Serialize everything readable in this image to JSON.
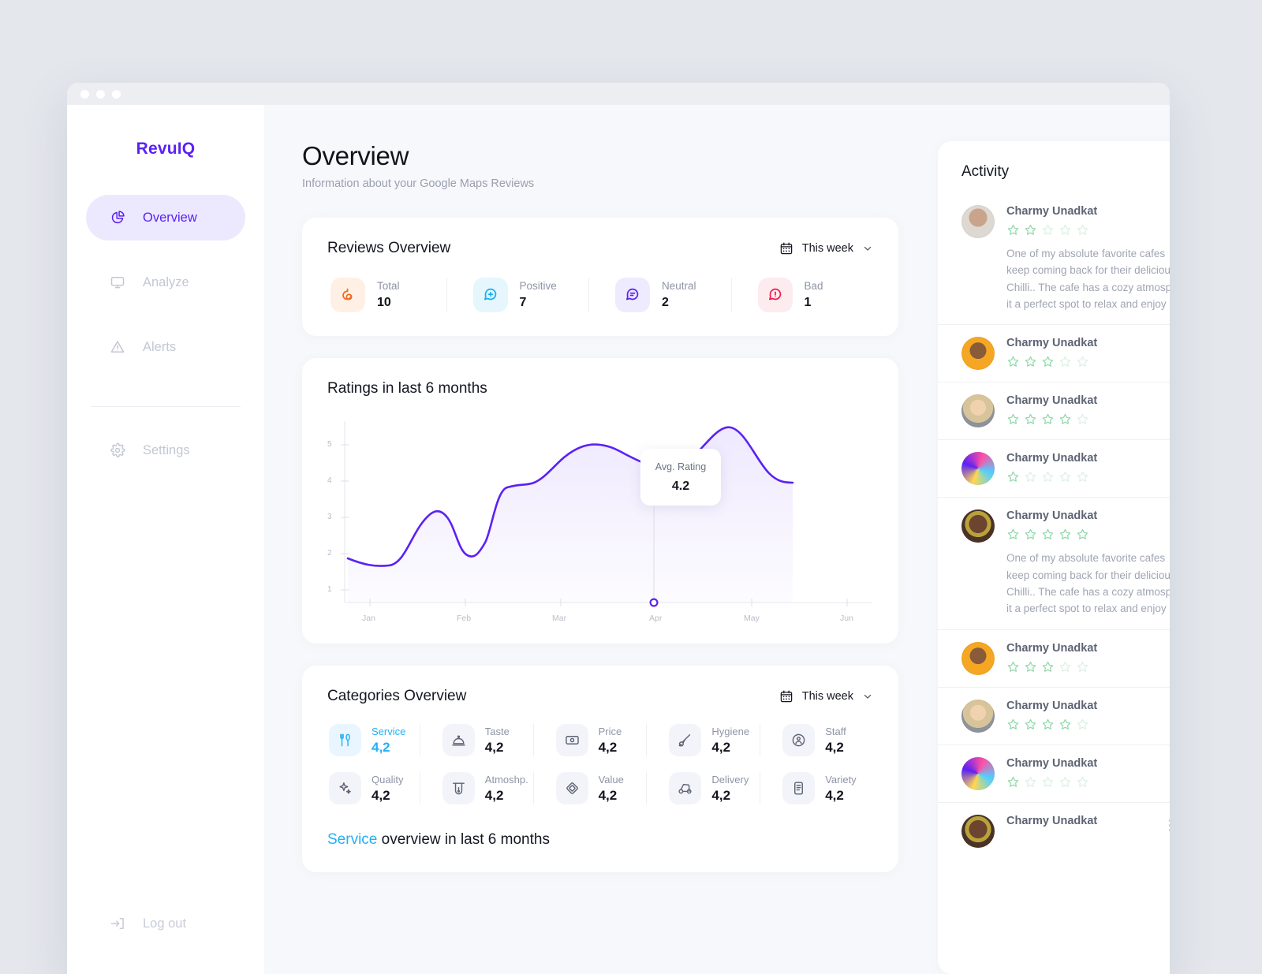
{
  "sidebar": {
    "logo": "RevuIQ",
    "items": [
      {
        "label": "Overview",
        "icon": "pie-chart-icon",
        "active": true
      },
      {
        "label": "Analyze",
        "icon": "monitor-icon",
        "active": false
      },
      {
        "label": "Alerts",
        "icon": "alert-triangle-icon",
        "active": false
      },
      {
        "label": "Settings",
        "icon": "gear-icon",
        "active": false
      }
    ],
    "logout": {
      "label": "Log out",
      "icon": "logout-icon"
    }
  },
  "header": {
    "title": "Overview",
    "subtitle": "Information about your Google Maps Reviews"
  },
  "reviews_overview": {
    "title": "Reviews Overview",
    "period": "This week",
    "stats": [
      {
        "label": "Total",
        "value": "10",
        "icon": "message-total-icon",
        "color": "#f26b1d",
        "bg": "#fff0e6"
      },
      {
        "label": "Positive",
        "value": "7",
        "icon": "message-plus-icon",
        "color": "#17b0f0",
        "bg": "#e6f6fd"
      },
      {
        "label": "Neutral",
        "value": "2",
        "icon": "message-neutral-icon",
        "color": "#5b21f5",
        "bg": "#eeebfe"
      },
      {
        "label": "Bad",
        "value": "1",
        "icon": "message-alert-icon",
        "color": "#f5194b",
        "bg": "#fdecef"
      }
    ]
  },
  "ratings_chart": {
    "title": "Ratings in last 6 months",
    "tooltip": {
      "label": "Avg. Rating",
      "value": "4.2"
    }
  },
  "chart_data": {
    "type": "line",
    "title": "Ratings in last 6 months",
    "xlabel": "",
    "ylabel": "",
    "categories": [
      "Jan",
      "Feb",
      "Mar",
      "Apr",
      "May",
      "Jun"
    ],
    "ylim": [
      0.5,
      5.7
    ],
    "yticks": [
      1,
      2,
      3,
      4,
      5
    ],
    "grid": false,
    "legend": false,
    "area_fill": true,
    "line_color": "#5b21f5",
    "annotation": {
      "label": "Avg. Rating",
      "value": 4.2,
      "x": "mid-Apr"
    },
    "series": [
      {
        "name": "Avg. Rating",
        "x": [
          "Jan",
          "Jan+",
          "Feb-",
          "Feb",
          "Feb+",
          "Mar-",
          "Mar",
          "Mar+",
          "Apr",
          "Apr+",
          "May-",
          "May",
          "May+",
          "Jun"
        ],
        "values": [
          1.95,
          1.72,
          3.3,
          2.9,
          2.15,
          3.8,
          3.85,
          4.4,
          5.25,
          4.92,
          4.88,
          5.15,
          5.55,
          4.6
        ]
      }
    ]
  },
  "categories_overview": {
    "title": "Categories Overview",
    "period": "This week",
    "rows": [
      [
        {
          "label": "Service",
          "value": "4,2",
          "icon": "cutlery-icon",
          "highlight": true
        },
        {
          "label": "Taste",
          "value": "4,2",
          "icon": "food-dome-icon",
          "highlight": false
        },
        {
          "label": "Price",
          "value": "4,2",
          "icon": "banknote-icon",
          "highlight": false
        },
        {
          "label": "Hygiene",
          "value": "4,2",
          "icon": "brush-icon",
          "highlight": false
        },
        {
          "label": "Staff",
          "value": "4,2",
          "icon": "user-badge-icon",
          "highlight": false
        }
      ],
      [
        {
          "label": "Quality",
          "value": "4,2",
          "icon": "sparkles-icon",
          "highlight": false
        },
        {
          "label": "Atmoshp.",
          "value": "4,2",
          "icon": "lamp-icon",
          "highlight": false
        },
        {
          "label": "Value",
          "value": "4,2",
          "icon": "diamond-icon",
          "highlight": false
        },
        {
          "label": "Delivery",
          "value": "4,2",
          "icon": "scooter-icon",
          "highlight": false
        },
        {
          "label": "Variety",
          "value": "4,2",
          "icon": "list-card-icon",
          "highlight": false
        }
      ]
    ],
    "footer_accent": "Service",
    "footer_rest": " overview in last 6 months"
  },
  "activity": {
    "title": "Activity",
    "review_text": "One of my absolute favorite cafes ... keep coming back for their delicious ... Chilli.. The cafe has a cozy atmosph... it a perfect spot to relax and enjoy ...",
    "review_lines": [
      "One of my absolute favorite cafes",
      "keep coming back for their deliciou",
      "Chilli.. The cafe has a cozy atmosp",
      "it a perfect spot to relax and enjoy"
    ],
    "items": [
      {
        "name": "Charmy Unadkat",
        "rating": 2,
        "avatar": "avatar-1",
        "has_text": true,
        "kebab": false
      },
      {
        "name": "Charmy Unadkat",
        "rating": 3,
        "avatar": "avatar-2",
        "has_text": false,
        "kebab": false
      },
      {
        "name": "Charmy Unadkat",
        "rating": 4,
        "avatar": "avatar-3",
        "has_text": false,
        "kebab": false
      },
      {
        "name": "Charmy Unadkat",
        "rating": 1,
        "avatar": "avatar-4",
        "has_text": false,
        "kebab": false
      },
      {
        "name": "Charmy Unadkat",
        "rating": 5,
        "avatar": "avatar-5",
        "has_text": true,
        "kebab": false
      },
      {
        "name": "Charmy Unadkat",
        "rating": 3,
        "avatar": "avatar-2",
        "has_text": false,
        "kebab": false
      },
      {
        "name": "Charmy Unadkat",
        "rating": 4,
        "avatar": "avatar-3",
        "has_text": false,
        "kebab": false
      },
      {
        "name": "Charmy Unadkat",
        "rating": 1,
        "avatar": "avatar-4",
        "has_text": false,
        "kebab": false
      },
      {
        "name": "Charmy Unadkat",
        "rating": 0,
        "avatar": "avatar-5",
        "has_text": false,
        "kebab": true
      }
    ]
  },
  "colors": {
    "brand": "#5b21f5",
    "accent": "#24b0f5",
    "page_bg": "#e4e7ec",
    "content_bg": "#f7f8fb",
    "card_bg": "#ffffff",
    "star_on": "#8ed8a8",
    "star_off": "#dcf0e3"
  }
}
